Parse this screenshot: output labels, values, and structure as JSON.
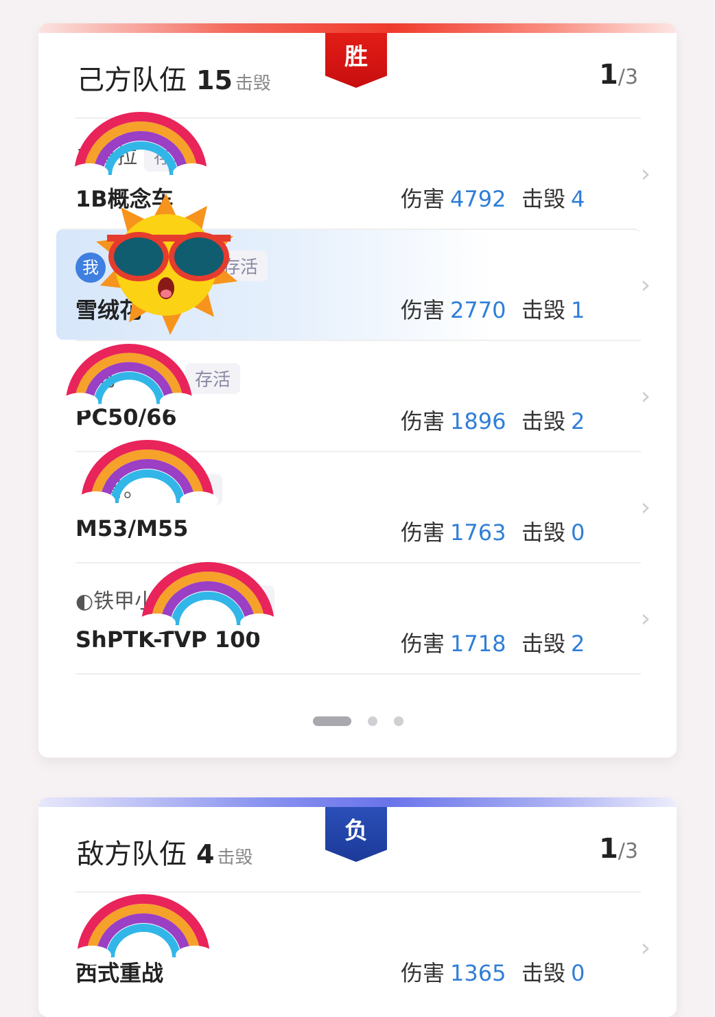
{
  "ally": {
    "ribbon": "胜",
    "title": "己方队伍",
    "kills": "15",
    "kills_unit": "击毁",
    "page_current": "1",
    "page_total": "/3",
    "rows": [
      {
        "player": "二哥拉",
        "status": "存活",
        "vehicle": "1B概念车",
        "damage_label": "伤害",
        "damage": "4792",
        "kills_label": "击毁",
        "kills": "4"
      },
      {
        "me_badge": "我",
        "player": "",
        "status": "存活",
        "vehicle": "雪绒花",
        "damage_label": "伤害",
        "damage": "2770",
        "kills_label": "击毁",
        "kills": "1"
      },
      {
        "player": "黑马",
        "status": "存活",
        "vehicle": "PC50/66",
        "damage_label": "伤害",
        "damage": "1896",
        "kills_label": "击毁",
        "kills": "2"
      },
      {
        "player": "哥。",
        "status": "活",
        "vehicle": "M53/M55",
        "damage_label": "伤害",
        "damage": "1763",
        "kills_label": "击毁",
        "kills": "0"
      },
      {
        "player": "◐铁甲小",
        "status": "活",
        "vehicle": "ShPTK-TVP 100",
        "damage_label": "伤害",
        "damage": "1718",
        "kills_label": "击毁",
        "kills": "2"
      }
    ]
  },
  "enemy": {
    "ribbon": "负",
    "title": "敌方队伍",
    "kills": "4",
    "kills_unit": "击毁",
    "page_current": "1",
    "page_total": "/3",
    "rows": [
      {
        "player": "",
        "status": "",
        "vehicle": "西式重战",
        "damage_label": "伤害",
        "damage": "1365",
        "kills_label": "击毁",
        "kills": "0"
      }
    ]
  },
  "colors": {
    "win": "#e21d16",
    "lose": "#2a4fb8",
    "value": "#2f7ed8"
  },
  "icons": {
    "chevron": "chevron-right-icon",
    "rainbow": "rainbow-sticker-icon",
    "sun": "sun-sunglasses-sticker-icon"
  }
}
